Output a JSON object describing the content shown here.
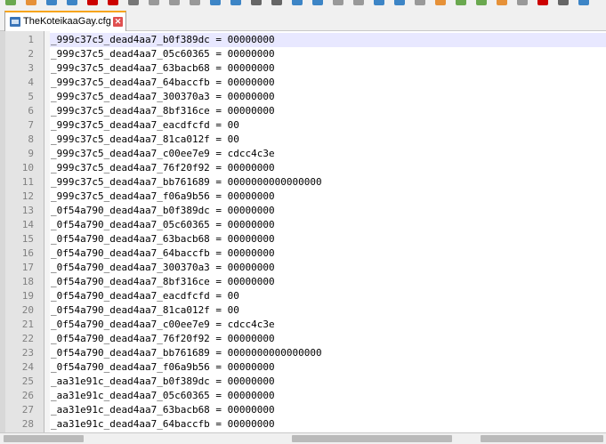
{
  "tab": {
    "label": "TheKoteikaaGay.cfg",
    "close_glyph": "✕"
  },
  "editor": {
    "current_line": 1,
    "lines": [
      {
        "num": "1",
        "text": "_999c37c5_dead4aa7_b0f389dc = 00000000"
      },
      {
        "num": "2",
        "text": "_999c37c5_dead4aa7_05c60365 = 00000000"
      },
      {
        "num": "3",
        "text": "_999c37c5_dead4aa7_63bacb68 = 00000000"
      },
      {
        "num": "4",
        "text": "_999c37c5_dead4aa7_64baccfb = 00000000"
      },
      {
        "num": "5",
        "text": "_999c37c5_dead4aa7_300370a3 = 00000000"
      },
      {
        "num": "6",
        "text": "_999c37c5_dead4aa7_8bf316ce = 00000000"
      },
      {
        "num": "7",
        "text": "_999c37c5_dead4aa7_eacdfcfd = 00"
      },
      {
        "num": "8",
        "text": "_999c37c5_dead4aa7_81ca012f = 00"
      },
      {
        "num": "9",
        "text": "_999c37c5_dead4aa7_c00ee7e9 = cdcc4c3e"
      },
      {
        "num": "10",
        "text": "_999c37c5_dead4aa7_76f20f92 = 00000000"
      },
      {
        "num": "11",
        "text": "_999c37c5_dead4aa7_bb761689 = 0000000000000000"
      },
      {
        "num": "12",
        "text": "_999c37c5_dead4aa7_f06a9b56 = 00000000"
      },
      {
        "num": "13",
        "text": "_0f54a790_dead4aa7_b0f389dc = 00000000"
      },
      {
        "num": "14",
        "text": "_0f54a790_dead4aa7_05c60365 = 00000000"
      },
      {
        "num": "15",
        "text": "_0f54a790_dead4aa7_63bacb68 = 00000000"
      },
      {
        "num": "16",
        "text": "_0f54a790_dead4aa7_64baccfb = 00000000"
      },
      {
        "num": "17",
        "text": "_0f54a790_dead4aa7_300370a3 = 00000000"
      },
      {
        "num": "18",
        "text": "_0f54a790_dead4aa7_8bf316ce = 00000000"
      },
      {
        "num": "19",
        "text": "_0f54a790_dead4aa7_eacdfcfd = 00"
      },
      {
        "num": "20",
        "text": "_0f54a790_dead4aa7_81ca012f = 00"
      },
      {
        "num": "21",
        "text": "_0f54a790_dead4aa7_c00ee7e9 = cdcc4c3e"
      },
      {
        "num": "22",
        "text": "_0f54a790_dead4aa7_76f20f92 = 00000000"
      },
      {
        "num": "23",
        "text": "_0f54a790_dead4aa7_bb761689 = 0000000000000000"
      },
      {
        "num": "24",
        "text": "_0f54a790_dead4aa7_f06a9b56 = 00000000"
      },
      {
        "num": "25",
        "text": "_aa31e91c_dead4aa7_b0f389dc = 00000000"
      },
      {
        "num": "26",
        "text": "_aa31e91c_dead4aa7_05c60365 = 00000000"
      },
      {
        "num": "27",
        "text": "_aa31e91c_dead4aa7_63bacb68 = 00000000"
      },
      {
        "num": "28",
        "text": "_aa31e91c_dead4aa7_64baccfb = 00000000"
      }
    ]
  },
  "colors": {
    "accent_tab": "#f7a51c",
    "current_line_bg": "#e8e8ff",
    "gutter_bg": "#e4e4e4"
  },
  "toolbar_icons": [
    "new-icon",
    "open-icon",
    "save-icon",
    "save-all-icon",
    "close-icon",
    "close-all-icon",
    "print-icon",
    "cut-icon",
    "copy-icon",
    "paste-icon",
    "undo-icon",
    "redo-icon",
    "find-icon",
    "replace-icon",
    "zoom-in-icon",
    "zoom-out-icon",
    "sync-v-icon",
    "sync-h-icon",
    "wrap-icon",
    "all-chars-icon",
    "indent-guide-icon",
    "udl-icon",
    "doc-map-icon",
    "function-list-icon",
    "folder-workspace-icon",
    "monitor-icon",
    "record-icon",
    "stop-icon",
    "play-icon"
  ]
}
